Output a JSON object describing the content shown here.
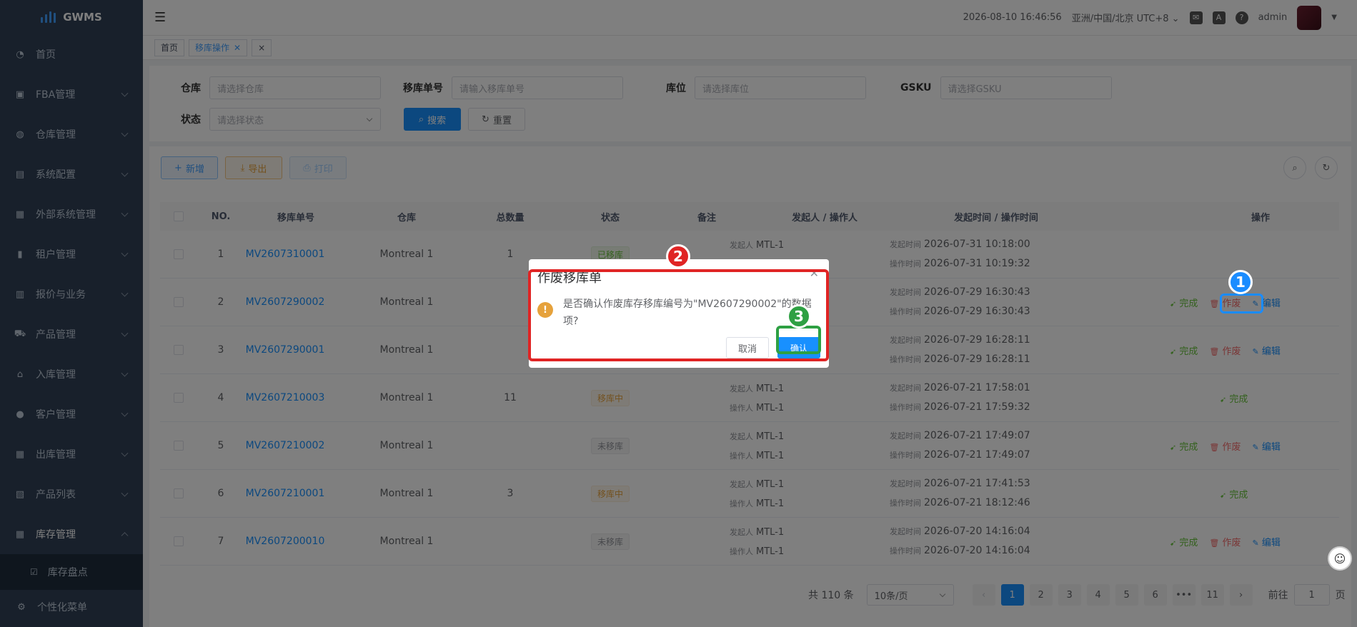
{
  "app": {
    "name": "GWMS"
  },
  "sidebar": {
    "items": [
      {
        "label": "首页",
        "icon": "dashboard-icon",
        "expandable": false
      },
      {
        "label": "FBA管理",
        "icon": "box-icon",
        "expandable": true
      },
      {
        "label": "仓库管理",
        "icon": "globe-icon",
        "expandable": true
      },
      {
        "label": "系统配置",
        "icon": "settings-icon",
        "expandable": true
      },
      {
        "label": "外部系统管理",
        "icon": "grid-icon",
        "expandable": true
      },
      {
        "label": "租户管理",
        "icon": "chart-icon",
        "expandable": true
      },
      {
        "label": "报价与业务",
        "icon": "document-icon",
        "expandable": true
      },
      {
        "label": "产品管理",
        "icon": "cart-icon",
        "expandable": true
      },
      {
        "label": "入库管理",
        "icon": "home-icon",
        "expandable": true
      },
      {
        "label": "客户管理",
        "icon": "user-icon",
        "expandable": true
      },
      {
        "label": "出库管理",
        "icon": "grid-icon",
        "expandable": true
      },
      {
        "label": "产品列表",
        "icon": "book-icon",
        "expandable": true
      },
      {
        "label": "库存管理",
        "icon": "table-icon",
        "expandable": true,
        "open": true
      }
    ],
    "subitem": "库存盘点",
    "footer": "个性化菜单"
  },
  "header": {
    "datetime": "2026-08-10 16:46:56",
    "timezone": "亚洲/中国/北京 UTC+8",
    "user": "admin"
  },
  "tags": {
    "home": "首页",
    "current": "移库操作",
    "close_all": "×"
  },
  "filters": {
    "warehouse_label": "仓库",
    "warehouse_placeholder": "请选择仓库",
    "order_label": "移库单号",
    "order_placeholder": "请输入移库单号",
    "location_label": "库位",
    "location_placeholder": "请选择库位",
    "gsku_label": "GSKU",
    "gsku_placeholder": "请选择GSKU",
    "status_label": "状态",
    "status_placeholder": "请选择状态",
    "search_btn": "搜索",
    "reset_btn": "重置"
  },
  "toolbar": {
    "add": "新增",
    "export": "导出",
    "print": "打印"
  },
  "table": {
    "headers": [
      "NO.",
      "移库单号",
      "仓库",
      "总数量",
      "状态",
      "备注",
      "发起人 / 操作人",
      "发起时间 / 操作时间",
      "操作"
    ],
    "initiator_label": "发起人",
    "operator_label": "操作人",
    "start_label": "发起时间",
    "op_label": "操作时间",
    "ops": {
      "done": "完成",
      "void": "作废",
      "edit": "编辑"
    },
    "rows": [
      {
        "no": "1",
        "order": "MV2607310001",
        "warehouse": "Montreal 1",
        "qty": "1",
        "status": "已移库",
        "status_type": "done",
        "initiator": "MTL-1",
        "operator": "",
        "start": "2026-07-31 10:18:00",
        "optime": "2026-07-31 10:19:32",
        "ops": []
      },
      {
        "no": "2",
        "order": "MV2607290002",
        "warehouse": "Montreal 1",
        "qty": "",
        "status": "",
        "status_type": "",
        "initiator": "",
        "operator": "",
        "start": "2026-07-29 16:30:43",
        "optime": "2026-07-29 16:30:43",
        "ops": [
          "done",
          "void",
          "edit"
        ]
      },
      {
        "no": "3",
        "order": "MV2607290001",
        "warehouse": "Montreal 1",
        "qty": "",
        "status": "",
        "status_type": "",
        "initiator": "",
        "operator": "",
        "start": "2026-07-29 16:28:11",
        "optime": "2026-07-29 16:28:11",
        "ops": [
          "done",
          "void",
          "edit"
        ]
      },
      {
        "no": "4",
        "order": "MV2607210003",
        "warehouse": "Montreal 1",
        "qty": "11",
        "status": "移库中",
        "status_type": "moving",
        "initiator": "MTL-1",
        "operator": "MTL-1",
        "start": "2026-07-21 17:58:01",
        "optime": "2026-07-21 17:59:32",
        "ops": [
          "done"
        ]
      },
      {
        "no": "5",
        "order": "MV2607210002",
        "warehouse": "Montreal 1",
        "qty": "",
        "status": "未移库",
        "status_type": "not",
        "initiator": "MTL-1",
        "operator": "MTL-1",
        "start": "2026-07-21 17:49:07",
        "optime": "2026-07-21 17:49:07",
        "ops": [
          "done",
          "void",
          "edit"
        ]
      },
      {
        "no": "6",
        "order": "MV2607210001",
        "warehouse": "Montreal 1",
        "qty": "3",
        "status": "移库中",
        "status_type": "moving",
        "initiator": "MTL-1",
        "operator": "MTL-1",
        "start": "2026-07-21 17:41:53",
        "optime": "2026-07-21 18:12:46",
        "ops": [
          "done"
        ]
      },
      {
        "no": "7",
        "order": "MV2607200010",
        "warehouse": "Montreal 1",
        "qty": "",
        "status": "未移库",
        "status_type": "not",
        "initiator": "MTL-1",
        "operator": "MTL-1",
        "start": "2026-07-20 14:16:04",
        "optime": "2026-07-20 14:16:04",
        "ops": [
          "done",
          "void",
          "edit"
        ]
      }
    ]
  },
  "pagination": {
    "total": "共 110 条",
    "page_size": "10条/页",
    "pages": [
      "1",
      "2",
      "3",
      "4",
      "5",
      "6",
      "•••",
      "11"
    ],
    "current": "1",
    "goto_label": "前往",
    "goto_value": "1",
    "page_unit": "页"
  },
  "dialog": {
    "title": "作废移库单",
    "message": "是否确认作废库存移库编号为\"MV2607290002\"的数据项?",
    "cancel": "取消",
    "confirm": "确认"
  },
  "annotations": [
    {
      "label": "1",
      "color": "#1a8cff"
    },
    {
      "label": "2",
      "color": "#e02424"
    },
    {
      "label": "3",
      "color": "#2ea043"
    }
  ]
}
